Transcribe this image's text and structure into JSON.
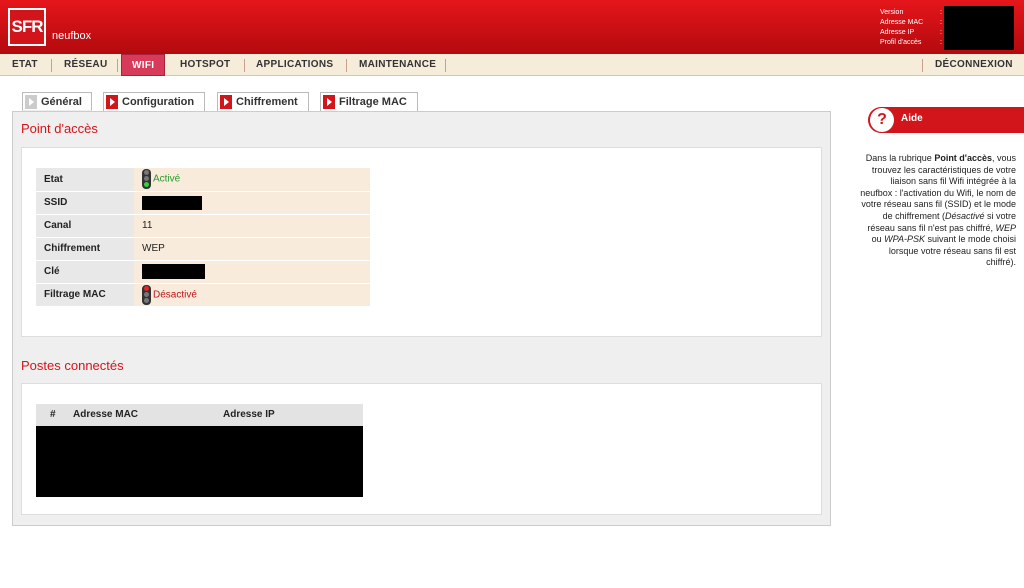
{
  "header": {
    "logo": "SFR",
    "brand": "neufbox",
    "info_labels": [
      "Version",
      "Adresse MAC",
      "Adresse IP",
      "Profil d'accès"
    ]
  },
  "nav": {
    "items": [
      "ETAT",
      "RÉSEAU",
      "WIFI",
      "HOTSPOT",
      "APPLICATIONS",
      "MAINTENANCE"
    ],
    "active": "WIFI",
    "logout": "DÉCONNEXION"
  },
  "tabs": [
    "Général",
    "Configuration",
    "Chiffrement",
    "Filtrage MAC"
  ],
  "access_point": {
    "title": "Point d'accès",
    "rows": [
      {
        "label": "Etat",
        "value": "Activé"
      },
      {
        "label": "SSID",
        "value": ""
      },
      {
        "label": "Canal",
        "value": "11"
      },
      {
        "label": "Chiffrement",
        "value": "WEP"
      },
      {
        "label": "Clé",
        "value": ""
      },
      {
        "label": "Filtrage MAC",
        "value": "Désactivé"
      }
    ]
  },
  "connected": {
    "title": "Postes connectés",
    "columns": [
      "#",
      "Adresse MAC",
      "Adresse IP"
    ]
  },
  "help": {
    "title": "Aide",
    "icon": "?",
    "p1": "Dans la rubrique ",
    "b1": "Point d'accès",
    "p2": ", vous trouvez les caractéristiques de votre liaison sans fil Wifi intégrée à la neufbox : l'activation du Wifi, le nom de votre réseau sans fil (SSID) et le mode de chiffrement (",
    "i1": "Désactivé",
    "p3": " si votre réseau sans fil n'est pas chiffré, ",
    "i2": "WEP",
    "p4": " ou ",
    "i3": "WPA-PSK",
    "p5": " suivant le mode choisi lorsque votre réseau sans fil est chiffré)."
  },
  "colors": {
    "brand_red": "#d2151b",
    "active_tab": "#d83b5a",
    "on": "#2a9a2a"
  }
}
